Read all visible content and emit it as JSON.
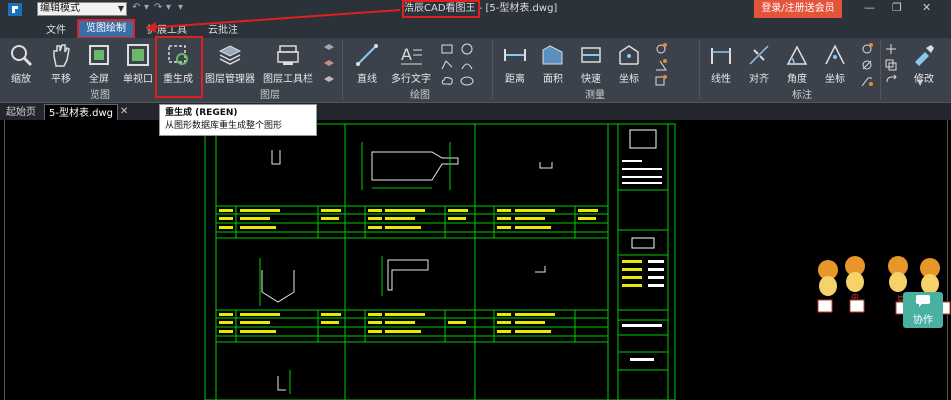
{
  "titlebar": {
    "mode_select": "编辑模式",
    "title": "浩辰CAD看图王 - [5-型材表.dwg]",
    "login_button": "登录/注册送会员"
  },
  "menu": {
    "items": [
      "文件",
      "览图绘制",
      "扩展工具",
      "云批注"
    ],
    "active": "览图绘制"
  },
  "ribbon": {
    "groups": [
      {
        "label": "览图",
        "buttons": [
          "缩放",
          "平移",
          "全屏",
          "单视口",
          "重生成"
        ]
      },
      {
        "label": "图层",
        "buttons": [
          "图层管理器",
          "图层工具栏"
        ]
      },
      {
        "label": "绘图",
        "buttons": [
          "直线",
          "多行文字"
        ]
      },
      {
        "label": "测量",
        "buttons": [
          "距离",
          "面积",
          "快速",
          "坐标"
        ]
      },
      {
        "label": "标注",
        "buttons": [
          "线性",
          "对齐",
          "角度",
          "坐标"
        ]
      },
      {
        "label": "",
        "buttons": [
          "修改"
        ]
      }
    ]
  },
  "tabs": {
    "items": [
      "起始页",
      "5-型材表.dwg"
    ],
    "active": "5-型材表.dwg"
  },
  "tooltip": {
    "title": "重生成 (REGEN)",
    "description": "从图形数据库重生成整个图形"
  },
  "overlay": {
    "collab_label": "协作",
    "mascot_chars": [
      "中",
      "简"
    ]
  },
  "colors": {
    "accent_red": "#e02020",
    "ribbon_bg": "#3b424b",
    "cad_green": "#00cc00",
    "cad_yellow": "#e8e800",
    "login_bg": "#e4533a"
  }
}
